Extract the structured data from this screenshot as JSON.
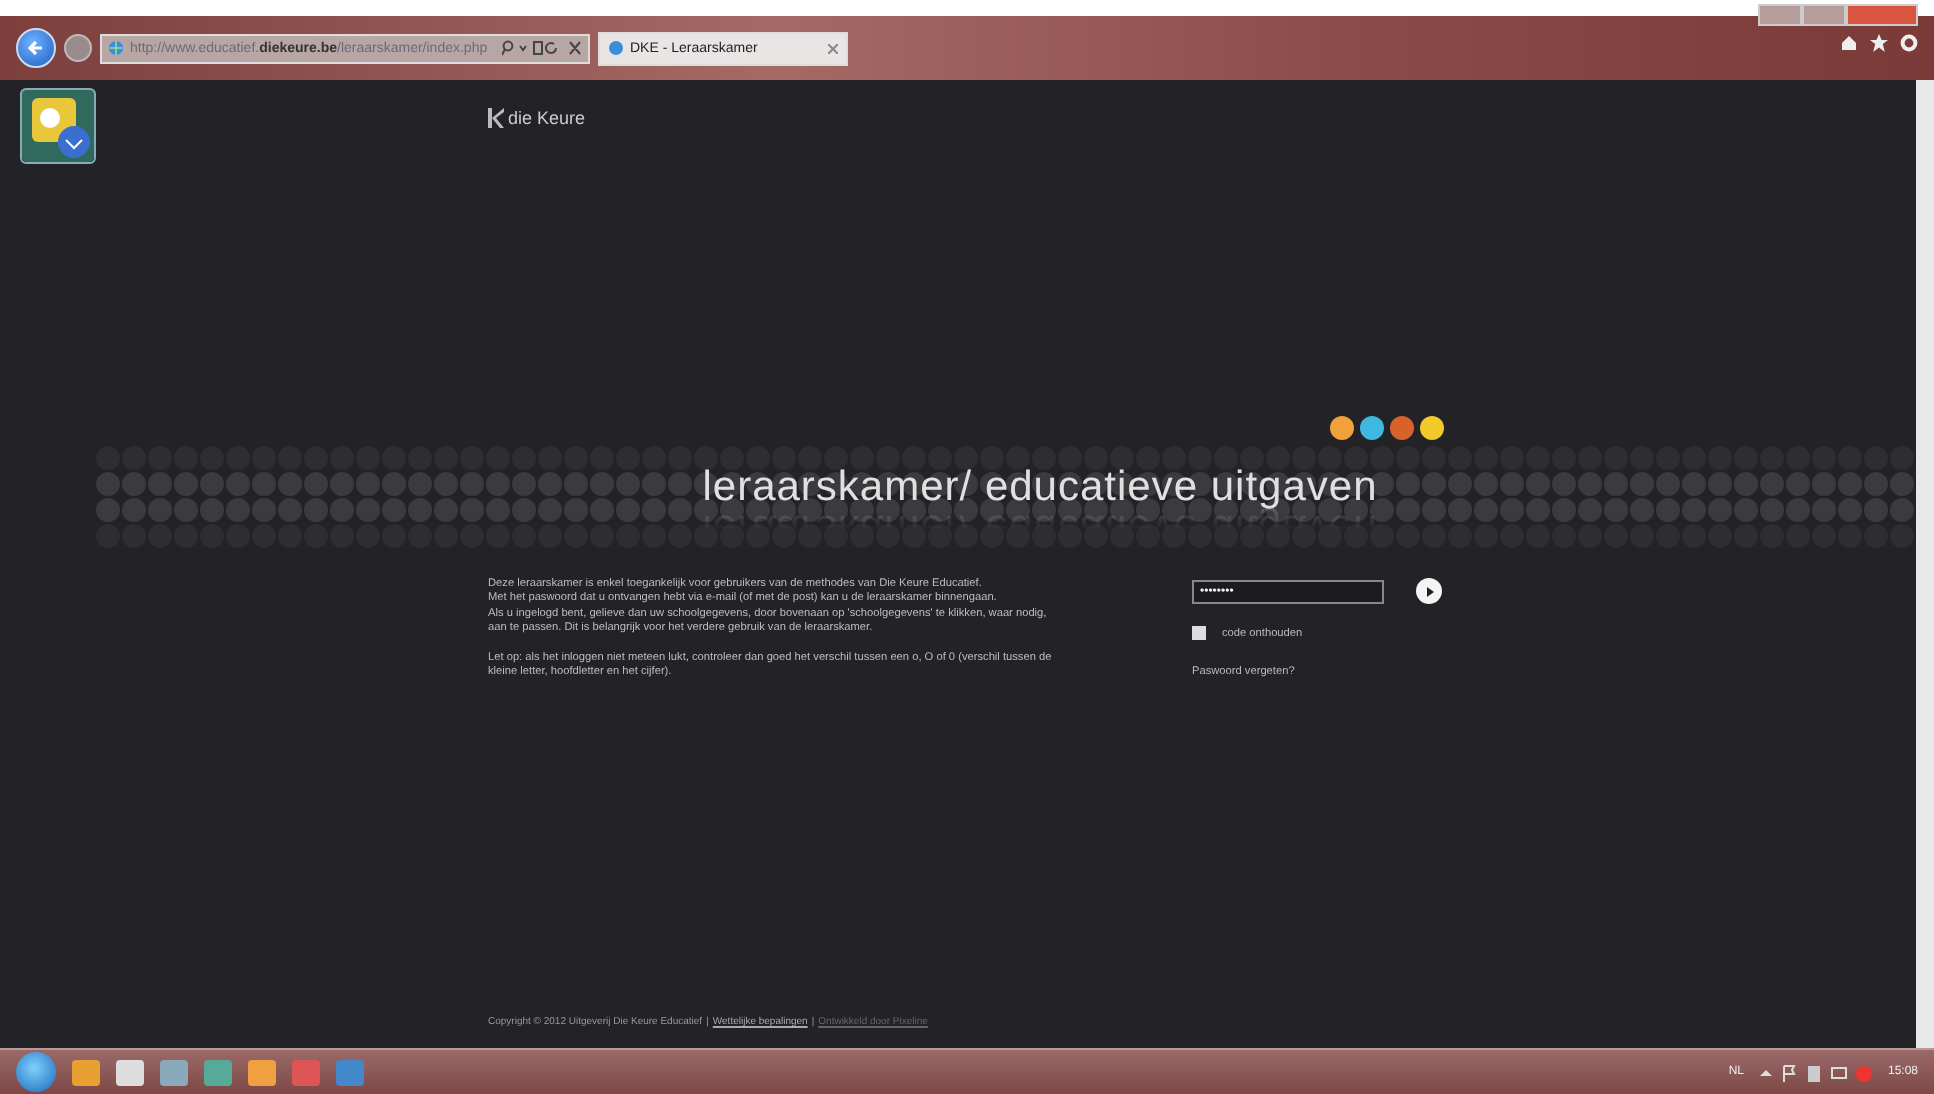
{
  "browser": {
    "address": "http://www.educatief.**diekeure.be**/leraarskamer/index.php",
    "tab": {
      "title": "DKE - Leraarskamer"
    }
  },
  "page": {
    "logo": "die Keure",
    "dots": [
      {
        "color": "#f2a03a"
      },
      {
        "color": "#3fb8e0"
      },
      {
        "color": "#d8632a"
      },
      {
        "color": "#f2c92a"
      }
    ],
    "title": "leraarskamer/ educatieve uitgaven",
    "paragraphs": [
      "Deze leraarskamer is enkel toegankelijk voor gebruikers van de methodes van Die Keure Educatief.\nMet het paswoord dat u ontvangen hebt via e-mail (of met de post) kan u de leraarskamer binnengaan.\nAls u ingelogd bent, gelieve dan uw schoolgegevens, door bovenaan op 'schoolgegevens' te klikken, waar nodig, aan te passen. Dit is belangrijk voor het verdere gebruik van de leraarskamer.",
      "Let op: als het inloggen niet meteen lukt, controleer dan goed het verschil tussen een o, O of 0 (verschil tussen de kleine letter, hoofdletter en het cijfer)."
    ],
    "password": {
      "value": "••••••••"
    },
    "remember": {
      "label": "code onthouden",
      "checked": false
    },
    "forgot": "Paswoord vergeten?",
    "footer": [
      {
        "kind": "text",
        "text": "Copyright © 2012 Uitgeverij Die Keure Educatief"
      },
      {
        "kind": "separator",
        "text": "|"
      },
      {
        "kind": "link",
        "text": "Wettelijke bepalingen"
      },
      {
        "kind": "separator",
        "text": "|"
      },
      {
        "kind": "dim-link",
        "text": "Ontwikkeld door Pixeline"
      }
    ]
  },
  "taskbar": {
    "language": "NL",
    "time": "15:08"
  }
}
